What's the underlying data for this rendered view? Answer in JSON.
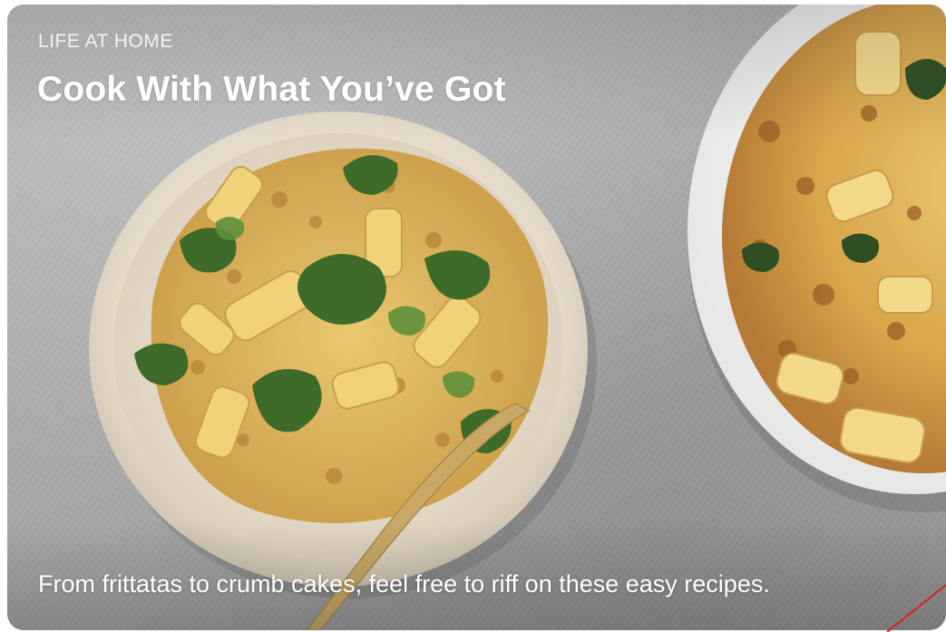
{
  "card": {
    "eyebrow": "LIFE AT HOME",
    "title": "Cook With What You’ve Got",
    "caption": "From frittatas to crumb cakes, feel free to riff on these easy recipes."
  },
  "image": {
    "subject": "pasta-bake-photo"
  },
  "colors": {
    "title_text": "#ffffff",
    "background": "#a9aaa9",
    "pointer_line": "#e02020"
  }
}
